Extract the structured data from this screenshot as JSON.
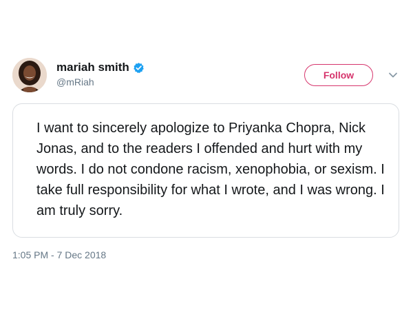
{
  "tweet": {
    "author": {
      "display_name": "mariah smith",
      "handle": "@mRiah",
      "verified": true,
      "avatar_icon": "avatar-photo"
    },
    "follow_label": "Follow",
    "menu_icon": "chevron-down-icon",
    "text": "I want to sincerely apologize to Priyanka Chopra, Nick Jonas, and to the readers I offended and hurt with my words. I do not condone racism, xenophobia, or sexism. I take full responsibility for what I wrote, and I was wrong. I am truly sorry.",
    "timestamp": "1:05 PM - 7 Dec 2018"
  },
  "colors": {
    "follow_accent": "#d6346c",
    "verified_badge": "#1da1f2",
    "secondary_text": "#657786",
    "card_border": "#d9dde1"
  }
}
